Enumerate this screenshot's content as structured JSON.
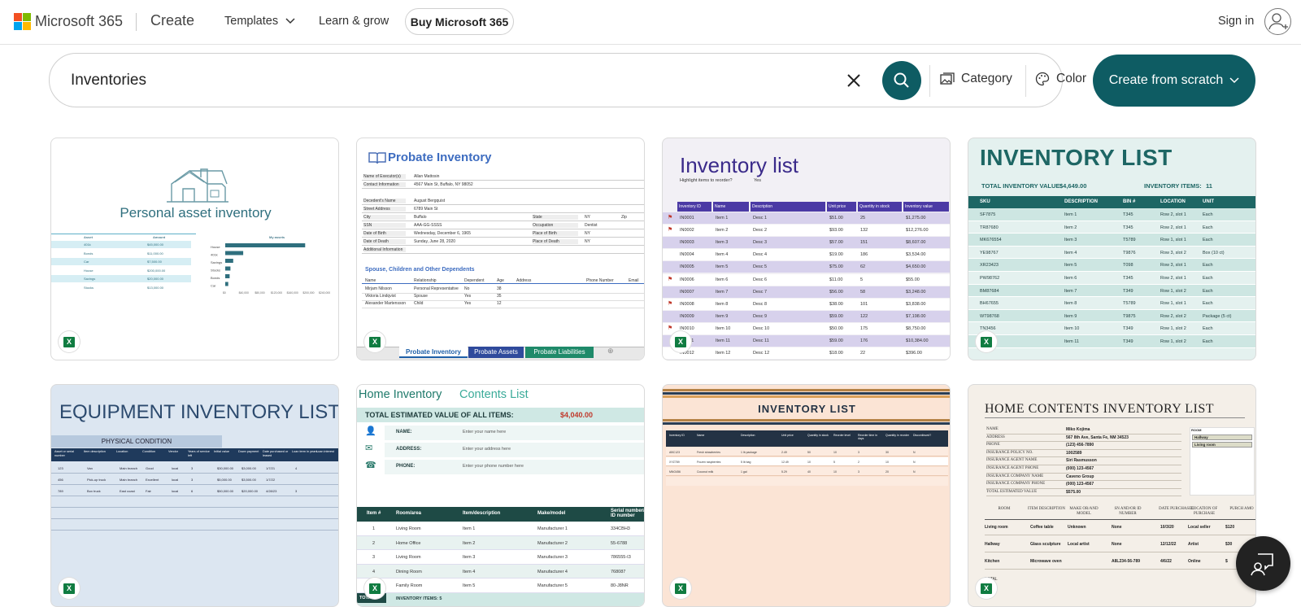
{
  "header": {
    "brand": "Microsoft 365",
    "section": "Create",
    "nav": [
      "Templates",
      "Learn & grow"
    ],
    "buy": "Buy Microsoft 365",
    "signin": "Sign in"
  },
  "search": {
    "value": "Inventories",
    "category": "Category",
    "color": "Color",
    "create": "Create from scratch"
  },
  "colors": {
    "accent": "#0e5c63",
    "excel": "#107c41"
  },
  "cards": [
    {
      "title": "Personal asset inventory",
      "table_headers": [
        "Asset",
        "Amount"
      ],
      "chart_title": "My assets",
      "rows": [
        [
          "401k",
          "$45,000.00"
        ],
        [
          "Bonds",
          "$11,000.00"
        ],
        [
          "Car",
          "$7,500.00"
        ],
        [
          "House",
          "$200,000.00"
        ],
        [
          "Savings",
          "$20,000.00"
        ],
        [
          "Stocks",
          "$13,000.00"
        ]
      ],
      "bar_labels": [
        "House",
        "401k",
        "Savings",
        "Stocks",
        "Bonds",
        "Car"
      ],
      "bar_values": [
        200000,
        45000,
        20000,
        13000,
        11000,
        7500
      ],
      "axis": [
        "$0",
        "$40,000",
        "$80,000",
        "$120,000",
        "$160,000",
        "$200,000",
        "$240,000"
      ]
    },
    {
      "title": "Probate Inventory",
      "executor": [
        [
          "Name of Executor(s)",
          "Allan Mattosin"
        ],
        [
          "Contact Information",
          "4567 Main St, Buffalo, NY 98052"
        ]
      ],
      "decedent": [
        [
          "Decedent's Name",
          "August Bergquist"
        ],
        [
          "Street Address",
          "6789 Main St"
        ],
        [
          "City",
          "Buffalo"
        ],
        [
          "SSN",
          "AAA-GG-SSSS"
        ],
        [
          "Date of Birth",
          "Wednesday, December 6, 1965"
        ],
        [
          "Date of Death",
          "Sunday, June 28, 2020"
        ],
        [
          "Additional Information",
          ""
        ]
      ],
      "side": [
        [
          "State",
          "NY"
        ],
        [
          "Occupation",
          "Dentist"
        ],
        [
          "Place of Birth",
          "NY"
        ],
        [
          "Place of Death",
          "NY"
        ]
      ],
      "zip": "Zip",
      "dep_title": "Spouse, Children and Other Dependents",
      "dep_headers": [
        "Name",
        "Relationship",
        "Dependent",
        "Age",
        "Address",
        "Phone Number",
        "Email"
      ],
      "deps": [
        [
          "Mirjam Nilsson",
          "Personal Representative",
          "No",
          "38"
        ],
        [
          "Viktoria Lindqvist",
          "Spouse",
          "Yes",
          "35"
        ],
        [
          "Alexander Martensson",
          "Child",
          "Yes",
          "12"
        ]
      ],
      "tabs": [
        "Probate Inventory",
        "Probate Assets",
        "Probate Liabilities"
      ]
    },
    {
      "title": "Inventory list",
      "highlight": "Highlight items to reorder?",
      "highlight_val": "Yes",
      "headers": [
        "Inventory ID",
        "Name",
        "Description",
        "Unit price",
        "Quantity in stock",
        "Inventory value"
      ],
      "rows": [
        [
          "IN0001",
          "Item 1",
          "Desc 1",
          "$51.00",
          "25",
          "$1,275.00"
        ],
        [
          "IN0002",
          "Item 2",
          "Desc 2",
          "$93.00",
          "132",
          "$12,276.00"
        ],
        [
          "IN0003",
          "Item 3",
          "Desc 3",
          "$57.00",
          "151",
          "$8,607.00"
        ],
        [
          "IN0004",
          "Item 4",
          "Desc 4",
          "$19.00",
          "186",
          "$3,534.00"
        ],
        [
          "IN0005",
          "Item 5",
          "Desc 5",
          "$75.00",
          "62",
          "$4,650.00"
        ],
        [
          "IN0006",
          "Item 6",
          "Desc 6",
          "$11.00",
          "5",
          "$55.00"
        ],
        [
          "IN0007",
          "Item 7",
          "Desc 7",
          "$56.00",
          "58",
          "$3,248.00"
        ],
        [
          "IN0008",
          "Item 8",
          "Desc 8",
          "$38.00",
          "101",
          "$3,838.00"
        ],
        [
          "IN0009",
          "Item 9",
          "Desc 9",
          "$59.00",
          "122",
          "$7,198.00"
        ],
        [
          "IN0010",
          "Item 10",
          "Desc 10",
          "$50.00",
          "175",
          "$8,750.00"
        ],
        [
          "IN0011",
          "Item 11",
          "Desc 11",
          "$59.00",
          "176",
          "$10,384.00"
        ],
        [
          "IN0012",
          "Item 12",
          "Desc 12",
          "$18.00",
          "22",
          "$396.00"
        ]
      ]
    },
    {
      "title": "INVENTORY LIST",
      "total_label": "TOTAL INVENTORY VALUE:",
      "total": "$4,649.00",
      "items_label": "INVENTORY ITEMS:",
      "items": "11",
      "headers": [
        "SKU",
        "DESCRIPTION",
        "BIN #",
        "LOCATION",
        "UNIT"
      ],
      "rows": [
        [
          "SF7875",
          "Item 1",
          "T345",
          "Row 2, slot 1",
          "Each"
        ],
        [
          "TR87680",
          "Item 2",
          "T345",
          "Row 2, slot 1",
          "Each"
        ],
        [
          "MK676554",
          "Item 3",
          "T5789",
          "Row 1, slot 1",
          "Each"
        ],
        [
          "YE98767",
          "Item 4",
          "T9876",
          "Row 3, slot 2",
          "Box (10 ct)"
        ],
        [
          "XR23423",
          "Item 5",
          "T098",
          "Row 3, slot 1",
          "Each"
        ],
        [
          "PW98762",
          "Item 6",
          "T345",
          "Row 2, slot 1",
          "Each"
        ],
        [
          "BM87684",
          "Item 7",
          "T349",
          "Row 1, slot 2",
          "Each"
        ],
        [
          "BH67655",
          "Item 8",
          "T5789",
          "Row 1, slot 1",
          "Each"
        ],
        [
          "WT98768",
          "Item 9",
          "T9875",
          "Row 2, slot 2",
          "Package (5 ct)"
        ],
        [
          "TN3456",
          "Item 10",
          "T349",
          "Row 1, slot 2",
          "Each"
        ],
        [
          "GS123",
          "Item 11",
          "T349",
          "Row 1, slot 2",
          "Each"
        ]
      ]
    },
    {
      "title": "EQUIPMENT INVENTORY LIST",
      "subtitle": "PHYSICAL CONDITION",
      "headers": [
        "Asset or serial number",
        "Item description",
        "Location",
        "Condition",
        "Vendor",
        "Years of service left",
        "Initial value",
        "Down payment",
        "Date purchased or leased",
        "Loan term in years",
        "Loan interest"
      ],
      "rows": [
        [
          "123",
          "Van",
          "Main branch",
          "Good",
          "local",
          "3",
          "$30,000.00",
          "$3,000.00",
          "1/7/21",
          "4",
          ""
        ],
        [
          "456",
          "Pick-up truck",
          "Main branch",
          "Excellent",
          "local",
          "3",
          "$5,000.00",
          "$3,500.00",
          "1/7/22",
          "",
          ""
        ],
        [
          "789",
          "Box truck",
          "East coast",
          "Fair",
          "local",
          "6",
          "$50,000.00",
          "$20,000.00",
          "4/28/23",
          "3",
          ""
        ]
      ]
    },
    {
      "title": "Home Inventory",
      "subtitle": "Contents List",
      "total_label": "TOTAL ESTIMATED VALUE OF ALL ITEMS:",
      "total": "$4,040.00",
      "fields": [
        [
          "NAME:",
          "Enter your name here"
        ],
        [
          "ADDRESS:",
          "Enter your address here"
        ],
        [
          "PHONE:",
          "Enter your phone number here"
        ]
      ],
      "headers": [
        "Item #",
        "Room/area",
        "Item/description",
        "Make/model",
        "Serial number/ ID number"
      ],
      "rows": [
        [
          "1",
          "Living Room",
          "Item 1",
          "Manufacturer 1",
          "334CBH3"
        ],
        [
          "2",
          "Home Office",
          "Item 2",
          "Manufacturer 2",
          "55-6788"
        ],
        [
          "3",
          "Living Room",
          "Item 3",
          "Manufacturer 3",
          "786555-I3"
        ],
        [
          "4",
          "Dining Room",
          "Item 4",
          "Manufacturer 4",
          "768087"
        ],
        [
          "5",
          "Family Room",
          "Item 5",
          "Manufacturer 5",
          "80-J8NR"
        ]
      ],
      "totals": "TOTALS",
      "items": "INVENTORY ITEMS: 5"
    },
    {
      "title": "INVENTORY LIST",
      "headers": [
        "Inventory ID",
        "Name",
        "Description",
        "Unit price",
        "Quantity in stock",
        "Reorder level",
        "Reorder time in days",
        "Quantity in reorder",
        "Discontinued?"
      ],
      "rows": [
        [
          "ABC123",
          "Fresh strawberries",
          "1 lb package",
          "2.49",
          "50",
          "10",
          "3",
          "30",
          "N"
        ],
        [
          "XYZ789",
          "Frozen raspberries",
          "5 lb bag",
          "12.49",
          "10",
          "5",
          "2",
          "10",
          "N"
        ],
        [
          "MNO456",
          "Coconut milk",
          "1 gal",
          "5.29",
          "40",
          "10",
          "3",
          "20",
          "N"
        ]
      ]
    },
    {
      "title": "HOME CONTENTS INVENTORY LIST",
      "fields": [
        [
          "NAME",
          "Miko Kojima"
        ],
        [
          "ADDRESS",
          "567 8th Ave, Santa Fe, NM 34523"
        ],
        [
          "PHONE",
          "(123) 456-7890"
        ],
        [
          "INSURANCE POLICY NO.",
          "1002589"
        ],
        [
          "INSURANCE AGENT NAME",
          "Siri Rasmusson"
        ],
        [
          "INSURANCE AGENT PHONE",
          "(000) 123-4567"
        ],
        [
          "INSURANCE COMPANY NAME",
          "Caveno Group"
        ],
        [
          "INSURANCE COMPANY PHONE",
          "(000) 123-4567"
        ],
        [
          "TOTAL ESTIMATED VALUE",
          "$575.00"
        ]
      ],
      "room_label": "ROOM",
      "rooms": [
        "Hallway",
        "Living room"
      ],
      "headers": [
        "ROOM",
        "ITEM DESCRIPTION",
        "MAKE OR/AND MODEL",
        "SN AND/OR ID NUMBER",
        "DATE PURCHASED",
        "LOCATION OF PURCHASE",
        "PURCH AMO"
      ],
      "rows": [
        [
          "Living room",
          "Coffee table",
          "Unknown",
          "None",
          "10/3/20",
          "Local seller",
          "$120"
        ],
        [
          "Hallway",
          "Glass sculpture",
          "Local artist",
          "None",
          "12/12/22",
          "Artist",
          "$30"
        ],
        [
          "Kitchen",
          "Microwave oven",
          "",
          "A8L234-56-789",
          "4/6/22",
          "Online",
          "$"
        ]
      ],
      "total": "TOTAL"
    }
  ]
}
